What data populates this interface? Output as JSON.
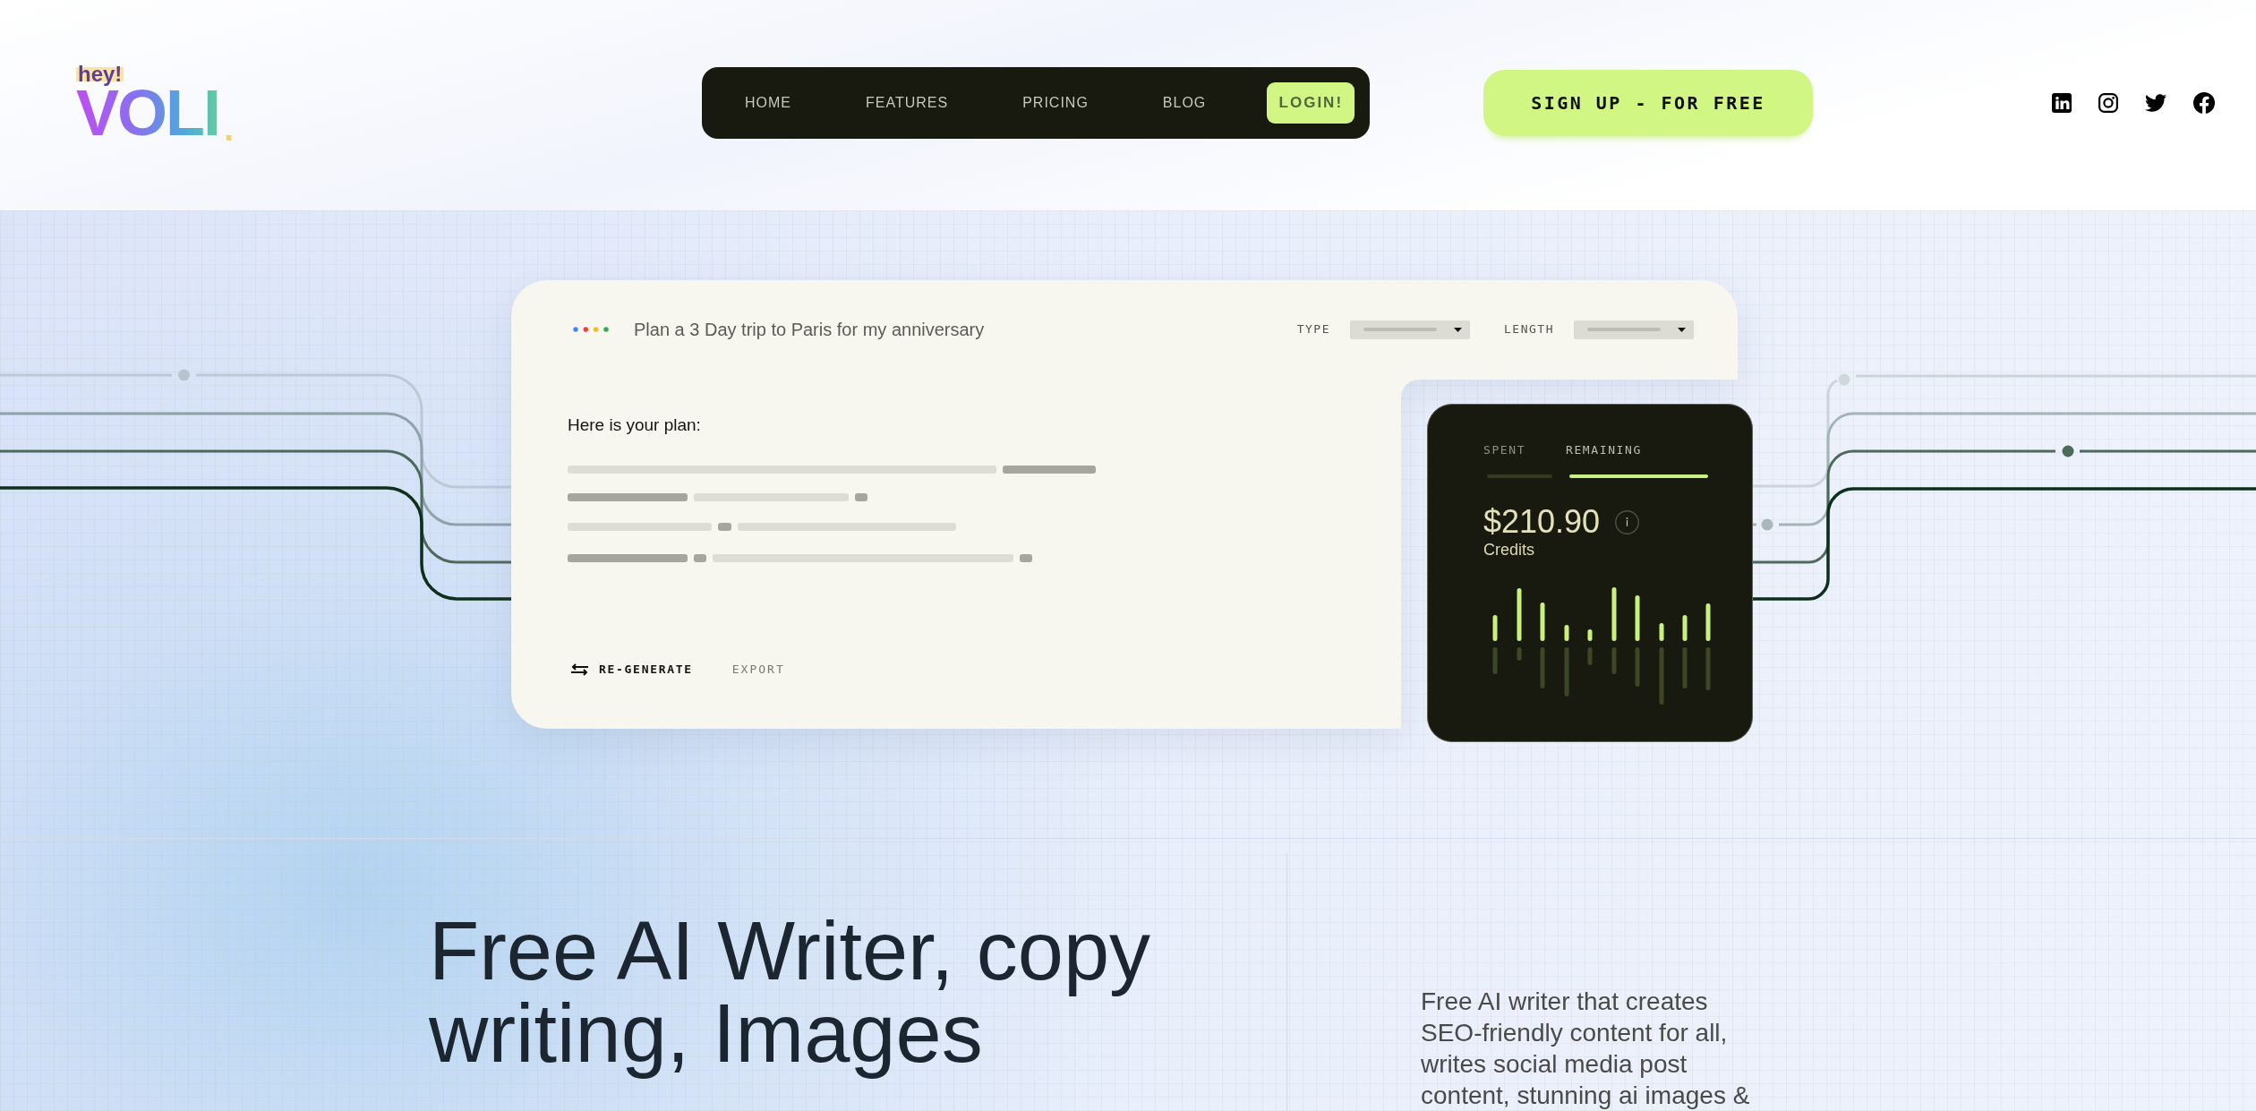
{
  "logo": {
    "tag": "hey!",
    "wordmark": "VOLI",
    "dot": "."
  },
  "nav": {
    "items": [
      "HOME",
      "FEATURES",
      "PRICING",
      "BLOG"
    ],
    "login": "LOGIN!"
  },
  "signup_button": "SIGN UP - FOR FREE",
  "prompt_card": {
    "prompt": "Plan a 3 Day trip to Paris for my anniversary",
    "filters": [
      "TYPE",
      "LENGTH"
    ],
    "result_heading": "Here is your plan:",
    "actions": [
      {
        "kind": "primary",
        "label": "RE-GENERATE"
      },
      {
        "kind": "secondary",
        "label": "EXPORT"
      }
    ]
  },
  "credits_panel": {
    "tabs": [
      {
        "label": "SPENT",
        "selected": false
      },
      {
        "label": "REMAINING",
        "selected": true
      }
    ],
    "amount": "$210.90",
    "caption": "Credits"
  },
  "hero": {
    "headline": [
      "Free AI Writer, copy",
      "writing, Images"
    ],
    "description": "Free AI writer that creates SEO-friendly content for all, writes social media post content, stunning ai images &"
  }
}
